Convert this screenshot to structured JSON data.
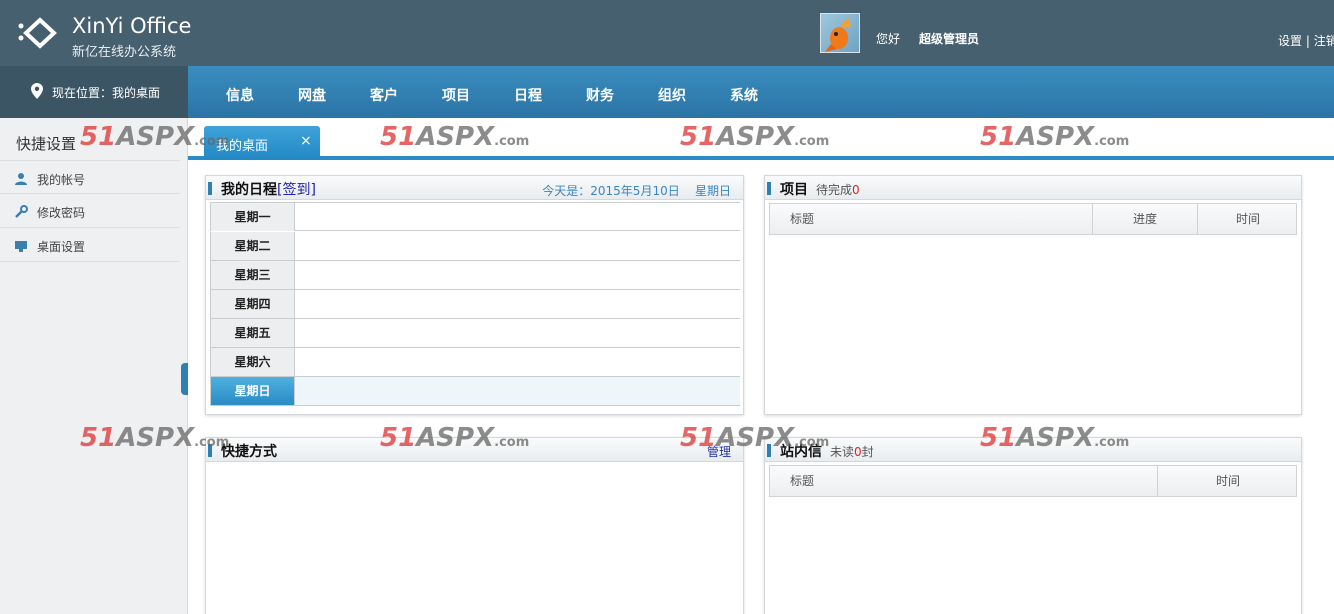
{
  "header": {
    "app_title": "XinYi Office",
    "app_subtitle": "新亿在线办公系统",
    "greeting": "您好",
    "user_name": "超级管理员",
    "settings_link": "设置",
    "separator": "|",
    "logout_link": "注销"
  },
  "nav": {
    "location": "现在位置：我的桌面",
    "items": [
      "信息",
      "网盘",
      "客户",
      "项目",
      "日程",
      "财务",
      "组织",
      "系统"
    ]
  },
  "sidebar": {
    "title": "快捷设置",
    "items": [
      {
        "label": "我的帐号",
        "icon": "user-icon"
      },
      {
        "label": "修改密码",
        "icon": "wrench-icon"
      },
      {
        "label": "桌面设置",
        "icon": "monitor-icon"
      }
    ]
  },
  "tabs": [
    {
      "label": "我的桌面",
      "close": "×"
    }
  ],
  "schedule": {
    "title": "我的日程",
    "sign_in": "[签到]",
    "today_label": "今天是：2015年5月10日",
    "weekday": "星期日",
    "days": [
      "星期一",
      "星期二",
      "星期三",
      "星期四",
      "星期五",
      "星期六",
      "星期日"
    ]
  },
  "projects": {
    "title": "项目",
    "pending_label": "待完成",
    "pending_count": "0",
    "columns": [
      "标题",
      "进度",
      "时间"
    ]
  },
  "shortcuts": {
    "title": "快捷方式",
    "manage": "管理"
  },
  "messages": {
    "title": "站内信",
    "unread_label": "未读",
    "unread_count": "0",
    "unread_suffix": "封",
    "columns": [
      "标题",
      "时间"
    ]
  },
  "watermark": {
    "num": "51",
    "word": "ASPX",
    "suffix": ".com"
  }
}
